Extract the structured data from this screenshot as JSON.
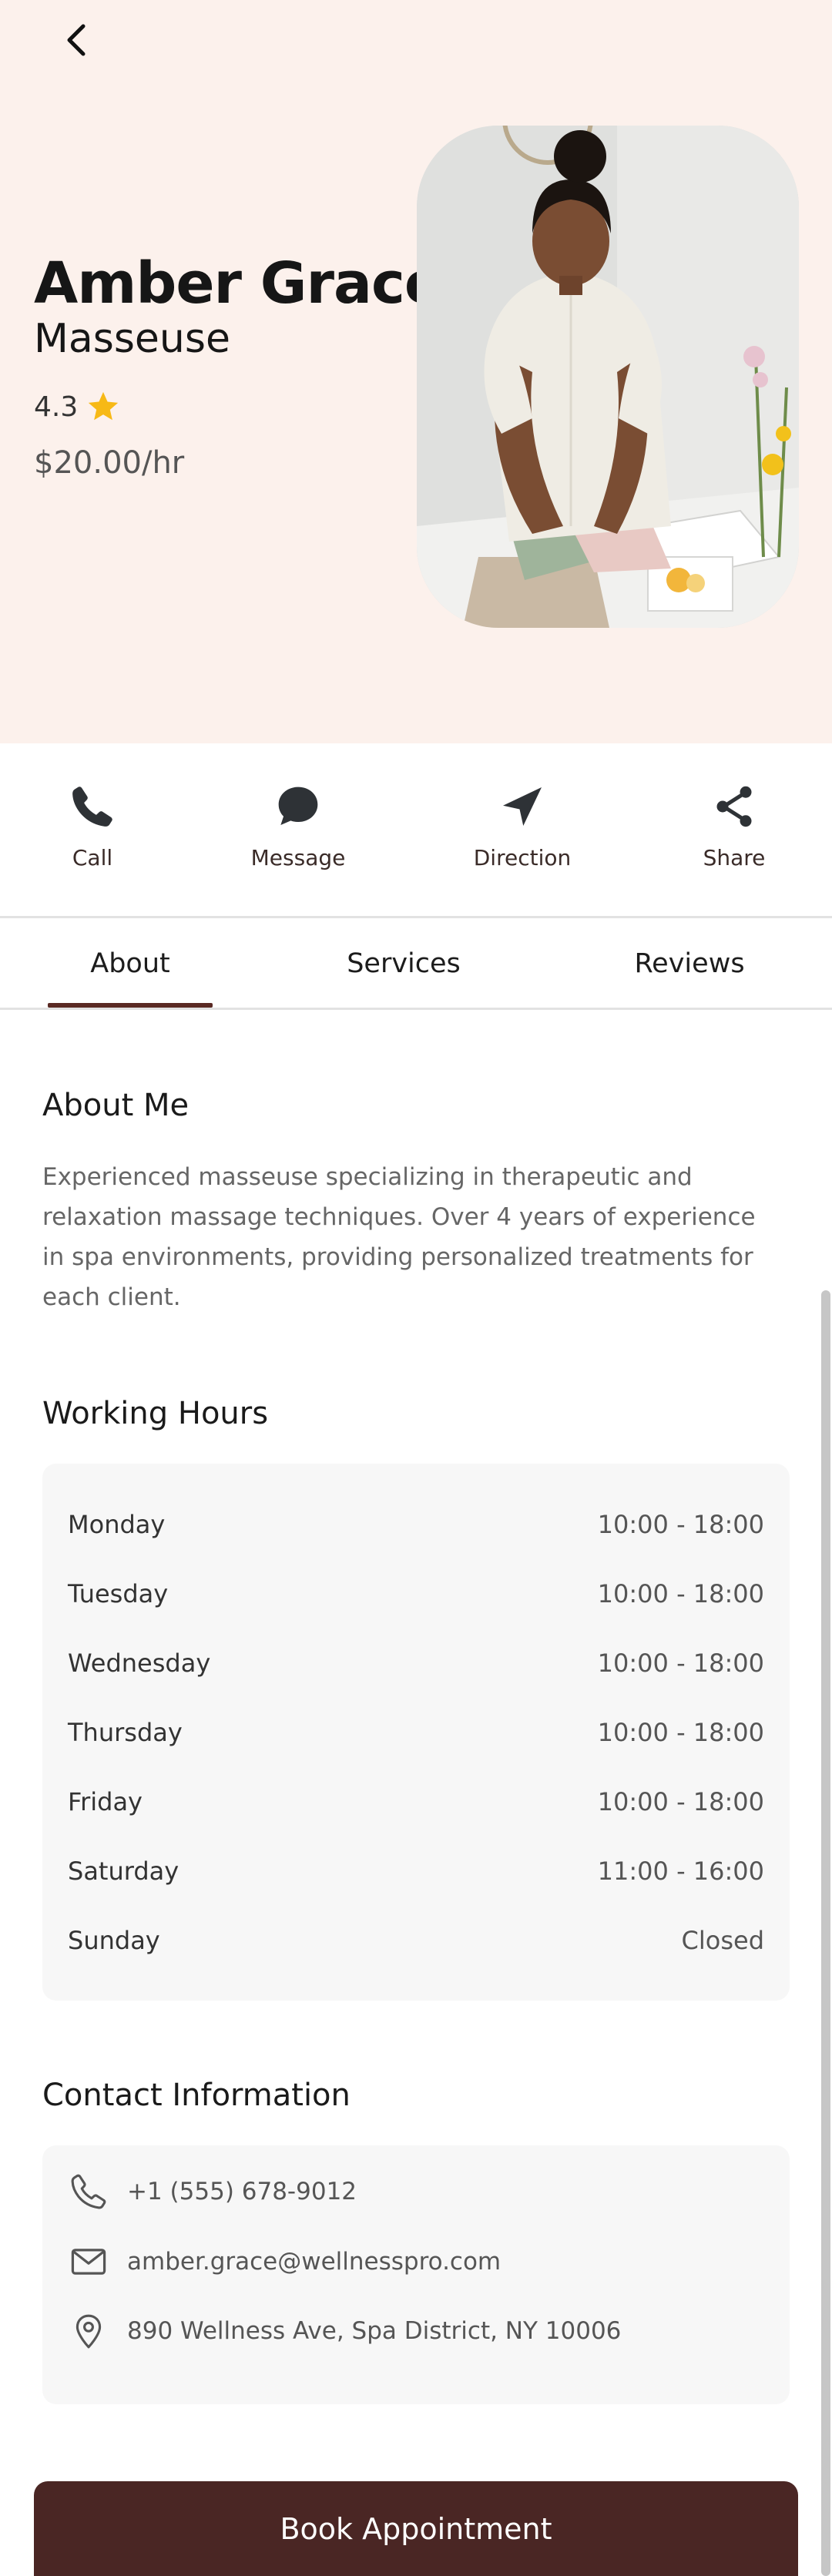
{
  "colors": {
    "hero_background": "#fcf1ec",
    "accent": "#4a2624",
    "tab_indicator": "#5a2a24",
    "star": "#f7b916",
    "card_background": "#f7f7f7"
  },
  "header": {
    "back_icon": "chevron-left-icon"
  },
  "profile": {
    "name": "Amber Grace",
    "role": "Masseuse",
    "rating": "4.3",
    "rating_icon": "star-icon",
    "price": "$20.00/hr",
    "photo_alt": "profile-photo"
  },
  "actions": [
    {
      "label": "Call",
      "icon": "phone-icon"
    },
    {
      "label": "Message",
      "icon": "chat-bubble-icon"
    },
    {
      "label": "Direction",
      "icon": "navigation-arrow-icon"
    },
    {
      "label": "Share",
      "icon": "share-icon"
    }
  ],
  "tabs": [
    {
      "label": "About",
      "selected": true
    },
    {
      "label": "Services",
      "selected": false
    },
    {
      "label": "Reviews",
      "selected": false
    }
  ],
  "about": {
    "title": "About Me",
    "text": "Experienced masseuse specializing in therapeutic and relaxation massage techniques. Over 4 years of experience in spa environments, providing personalized treatments for each client."
  },
  "working_hours": {
    "title": "Working Hours",
    "rows": [
      {
        "day": "Monday",
        "time": "10:00 - 18:00"
      },
      {
        "day": "Tuesday",
        "time": "10:00 - 18:00"
      },
      {
        "day": "Wednesday",
        "time": "10:00 - 18:00"
      },
      {
        "day": "Thursday",
        "time": "10:00 - 18:00"
      },
      {
        "day": "Friday",
        "time": "10:00 - 18:00"
      },
      {
        "day": "Saturday",
        "time": "11:00 - 16:00"
      },
      {
        "day": "Sunday",
        "time": "Closed"
      }
    ]
  },
  "contact": {
    "title": "Contact Information",
    "phone": "+1 (555) 678-9012",
    "email": "amber.grace@wellnesspro.com",
    "address": "890 Wellness Ave, Spa District, NY 10006",
    "phone_icon": "phone-outline-icon",
    "email_icon": "mail-icon",
    "address_icon": "map-pin-icon"
  },
  "book_button": {
    "label": "Book Appointment"
  }
}
